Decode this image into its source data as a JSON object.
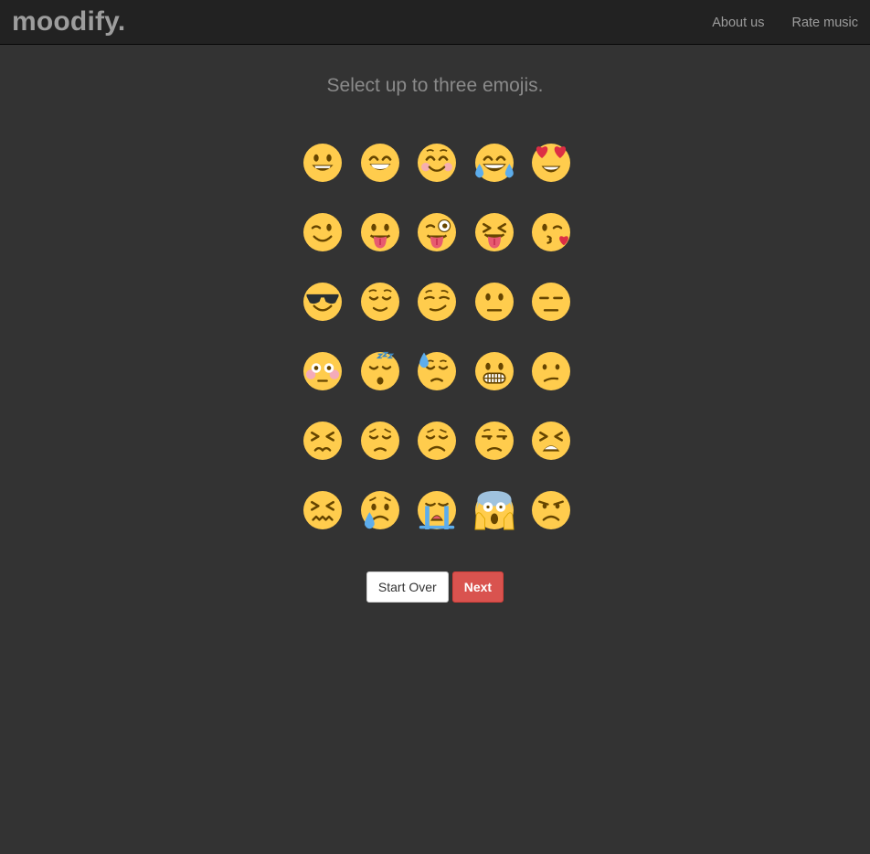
{
  "navbar": {
    "brand": "moodify.",
    "links": [
      "About us",
      "Rate music"
    ]
  },
  "heading": "Select up to three emojis.",
  "colors": {
    "background": "#333333",
    "navbar": "#222222",
    "emoji_face": "#FFCC4D",
    "emoji_feature": "#664500",
    "next_button": "#d9534f"
  },
  "emojis": [
    "grinning-face-icon",
    "grinning-face-with-smiling-eyes-icon",
    "smiling-face-icon",
    "face-with-tears-of-joy-icon",
    "heart-eyes-icon",
    "winking-face-icon",
    "face-with-tongue-icon",
    "winking-face-with-tongue-icon",
    "squinting-face-with-tongue-icon",
    "face-blowing-kiss-icon",
    "smiling-face-with-sunglasses-icon",
    "relieved-face-icon",
    "smirking-face-icon",
    "neutral-face-icon",
    "expressionless-face-icon",
    "flushed-face-icon",
    "sleeping-face-icon",
    "downcast-face-with-sweat-icon",
    "grimacing-face-icon",
    "confused-face-icon",
    "persevering-face-icon",
    "pensive-face-icon",
    "disappointed-face-icon",
    "unamused-face-icon",
    "tired-face-icon",
    "confounded-face-icon",
    "crying-face-icon",
    "loudly-crying-face-icon",
    "face-screaming-in-fear-icon",
    "angry-face-icon"
  ],
  "buttons": {
    "start_over": "Start Over",
    "next": "Next"
  }
}
